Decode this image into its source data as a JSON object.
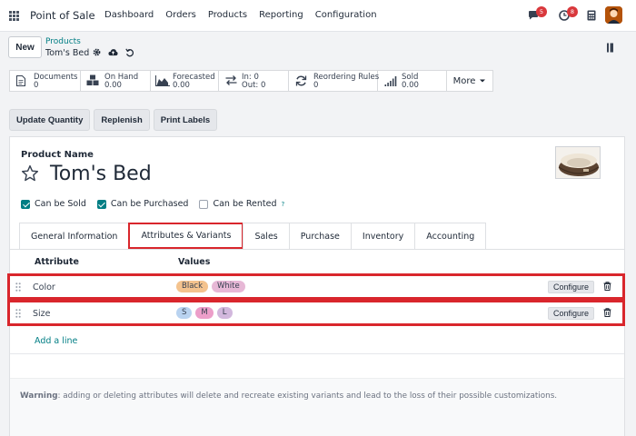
{
  "navbar": {
    "app_name": "Point of Sale",
    "menu": [
      "Dashboard",
      "Orders",
      "Products",
      "Reporting",
      "Configuration"
    ],
    "messages_count": "5",
    "activity_count": "8"
  },
  "control": {
    "new_label": "New",
    "breadcrumb_parent": "Products",
    "breadcrumb_current": "Tom's Bed"
  },
  "smart_buttons": [
    {
      "label": "Documents",
      "value": "0",
      "icon": "file-icon"
    },
    {
      "label": "On Hand",
      "value": "0.00",
      "icon": "cubes-icon"
    },
    {
      "label": "Forecasted",
      "value": "0.00",
      "icon": "area-chart-icon"
    },
    {
      "label": "In: 0",
      "value": "Out: 0",
      "icon": "exchange-icon"
    },
    {
      "label": "Reordering Rules",
      "value": "0",
      "icon": "refresh-icon"
    },
    {
      "label": "Sold",
      "value": "0.00",
      "icon": "signal-icon"
    },
    {
      "label": "More",
      "value": "",
      "icon": "caret-down-icon"
    }
  ],
  "actions": [
    "Update Quantity",
    "Replenish",
    "Print Labels"
  ],
  "form": {
    "product_name_label": "Product Name",
    "product_name": "Tom's Bed",
    "checkboxes": [
      {
        "label": "Can be Sold",
        "checked": true
      },
      {
        "label": "Can be Purchased",
        "checked": true
      },
      {
        "label": "Can be Rented",
        "checked": false,
        "help": "?"
      }
    ]
  },
  "tabs": [
    "General Information",
    "Attributes & Variants",
    "Sales",
    "Purchase",
    "Inventory",
    "Accounting"
  ],
  "active_tab": "Attributes & Variants",
  "table": {
    "headers": [
      "Attribute",
      "Values"
    ],
    "rows": [
      {
        "attribute": "Color",
        "values": [
          {
            "label": "Black",
            "color": "#f4c38e"
          },
          {
            "label": "White",
            "color": "#e7b8d6"
          }
        ],
        "configure": "Configure"
      },
      {
        "attribute": "Size",
        "values": [
          {
            "label": "S",
            "color": "#b9d3f0"
          },
          {
            "label": "M",
            "color": "#ec9ec9"
          },
          {
            "label": "L",
            "color": "#d2b8dd"
          }
        ],
        "configure": "Configure"
      }
    ],
    "add_line": "Add a line"
  },
  "warning": {
    "label": "Warning",
    "text": ": adding or deleting attributes will delete and recreate existing variants and lead to the loss of their possible customizations."
  },
  "colors": {
    "accent": "#017e84",
    "highlight": "#d9262c",
    "badge": "#d9383c"
  }
}
